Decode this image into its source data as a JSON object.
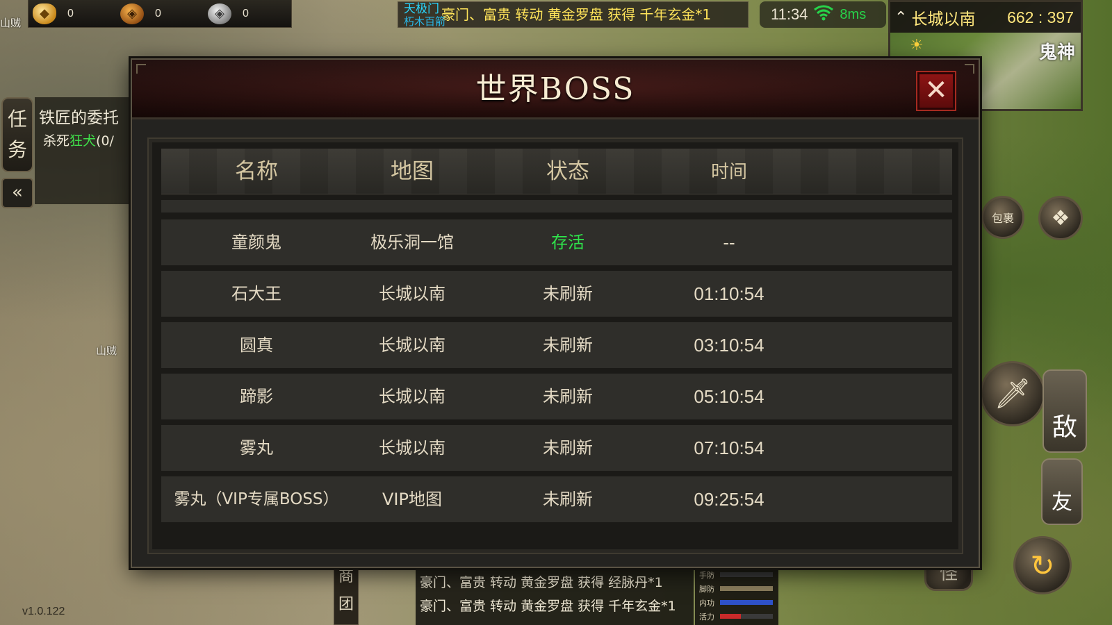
{
  "resources": [
    {
      "icon": "gold-ingot-icon",
      "value": "0"
    },
    {
      "icon": "copper-coin-icon",
      "value": "0"
    },
    {
      "icon": "silver-coin-icon",
      "value": "0"
    }
  ],
  "broadcast": {
    "tag_line1": "天极门",
    "tag_line2": "朽木百箭",
    "text": "豪门、富贵 转动 黄金罗盘 获得 千年玄金*1"
  },
  "status": {
    "time": "11:34",
    "ping": "8ms"
  },
  "minimap": {
    "location": "长城以南",
    "coords": "662 : 397",
    "npc_label": "鬼神"
  },
  "quest": {
    "tab_label_1": "任",
    "tab_label_2": "务",
    "title": "铁匠的委托",
    "desc_prefix": "杀死",
    "desc_target": "狂犬",
    "desc_suffix": "(0/"
  },
  "world_labels": {
    "bandit": "山贼",
    "bandit_top": "山贼"
  },
  "right_buttons": {
    "bag": "包裹",
    "enemy": "敌",
    "friend": "友",
    "monster": "怪"
  },
  "bottom": {
    "guild_1": "商",
    "guild_2": "团",
    "chat": [
      "豪门、富贵 转动 黄金罗盘 获得 经脉丹*1",
      "豪门、富贵 转动 黄金罗盘 获得 千年玄金*1"
    ],
    "vitals": [
      {
        "label": "手防",
        "fill": 0.0,
        "color": "#7a6e52"
      },
      {
        "label": "脚防",
        "fill": 1.0,
        "color": "#8a7d5c"
      },
      {
        "label": "内功",
        "fill": 1.0,
        "color": "#2f52c9"
      },
      {
        "label": "活力",
        "fill": 0.4,
        "color": "#c92a2a"
      }
    ],
    "version": "v1.0.122"
  },
  "dialog": {
    "title": "世界BOSS",
    "close_symbol": "✕",
    "columns": [
      "名称",
      "地图",
      "状态",
      "时间"
    ],
    "rows": [
      {
        "name": "童颜鬼",
        "map": "极乐洞一馆",
        "status": "存活",
        "time": "--",
        "alive": true
      },
      {
        "name": "石大王",
        "map": "长城以南",
        "status": "未刷新",
        "time": "01:10:54",
        "alive": false
      },
      {
        "name": "圆真",
        "map": "长城以南",
        "status": "未刷新",
        "time": "03:10:54",
        "alive": false
      },
      {
        "name": "蹄影",
        "map": "长城以南",
        "status": "未刷新",
        "time": "05:10:54",
        "alive": false
      },
      {
        "name": "雾丸",
        "map": "长城以南",
        "status": "未刷新",
        "time": "07:10:54",
        "alive": false
      },
      {
        "name": "雾丸（VIP专属BOSS）",
        "map": "VIP地图",
        "status": "未刷新",
        "time": "09:25:54",
        "alive": false
      }
    ]
  },
  "colors": {
    "alive_status": "#2fe44b",
    "ping_good": "#27d34a",
    "broadcast_text": "#ffe45a",
    "location_text": "#ffe77d"
  }
}
